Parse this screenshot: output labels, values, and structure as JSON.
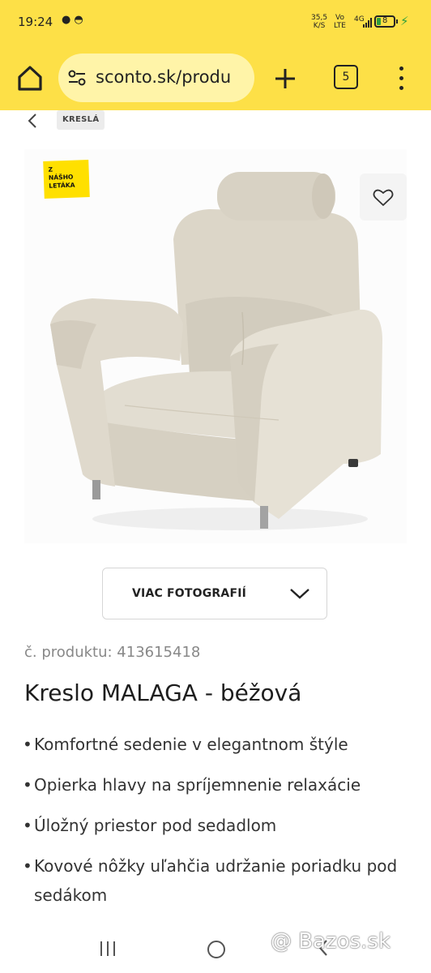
{
  "status_bar": {
    "time": "19:24",
    "net_speed_value": "35,5",
    "net_speed_unit": "K/S",
    "volte_top": "Vo",
    "volte_bottom": "LTE",
    "signal_label": "4G",
    "battery_level": "8",
    "battery_color": "#2e9e3c"
  },
  "browser": {
    "url": "sconto.sk/produ",
    "tab_count": "5",
    "toolbar_color": "#fde047"
  },
  "breadcrumb": {
    "category": "KRESLÁ"
  },
  "product": {
    "promo_badge_lines": [
      "Z",
      "NÁŠHO",
      "LETÁKA"
    ],
    "more_photos_label": "VIAC FOTOGRAFIÍ",
    "code": "č. produktu: 413615418",
    "title": "Kreslo MALAGA - béžová",
    "features": [
      "Komfortné sedenie v elegantnom štýle",
      "Opierka hlavy na spríjemnenie relaxácie",
      "Úložný priestor pod sedadlom",
      "Kovové nôžky uľahčia udržanie poriadku pod sedákom"
    ]
  },
  "watermark": "@ Bazos.sk"
}
